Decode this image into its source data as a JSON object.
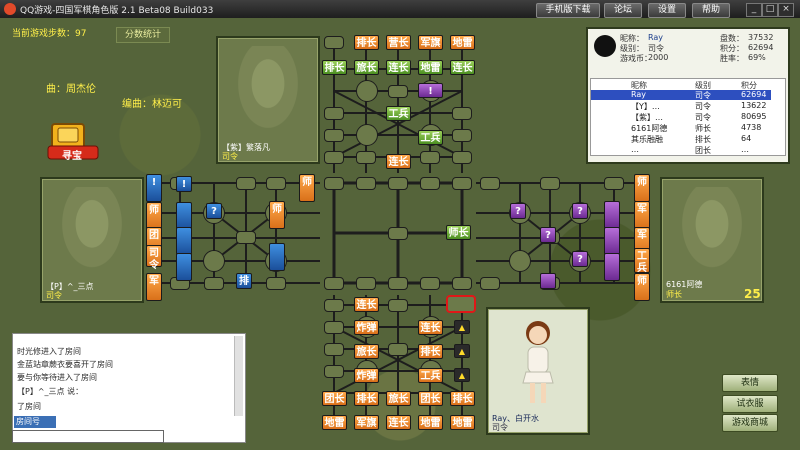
{
  "titlebar": {
    "title": "QQ游戏-四国军棋角色版 2.1 Beta08 Build033",
    "buttons": [
      "手机版下载",
      "论坛",
      "设置",
      "帮助"
    ],
    "window_controls": [
      "_",
      "□",
      "×"
    ]
  },
  "left": {
    "step_count": "当前游戏步数：97",
    "score_button": "分数统计",
    "lyric_line1": "曲：周杰伦",
    "lyric_line2": "编曲：林迈可",
    "treasure_label": "寻宝"
  },
  "seats": {
    "top": {
      "name": "【紫】繁落凡",
      "rank": "司令"
    },
    "left": {
      "name": "【P】^_三点",
      "rank": "司令"
    },
    "right": {
      "name": "6161阿德",
      "rank": "师长",
      "timer": "25"
    },
    "bottom": {
      "name": "Ray、白开水",
      "rank": "司令"
    }
  },
  "board": {
    "north": [
      [
        "排长",
        "营长",
        "军旗",
        "地雷"
      ],
      [
        "排长",
        "旅长",
        "连长",
        "地雷",
        "连长"
      ],
      [
        "!"
      ],
      [
        "工兵"
      ],
      [
        "工兵"
      ],
      [
        "连长"
      ]
    ],
    "west_col1": [
      "!",
      "师",
      "?"
    ],
    "west_labels": [
      "师",
      "团",
      "司令",
      "军"
    ],
    "west_other": [
      "?",
      "师",
      "排",
      "?"
    ],
    "east_labels": [
      "师",
      "军",
      "军",
      "工兵",
      "师"
    ],
    "east_hidden": [
      "?",
      "?",
      "?",
      "?"
    ],
    "center": [
      "师长"
    ],
    "south": [
      [
        "连长"
      ],
      [
        "炸弹",
        "连长"
      ],
      [
        "旅长",
        "排长"
      ],
      [
        "炸弹",
        "工兵"
      ],
      [
        "团长",
        "排长",
        "旅长",
        "团长",
        "排长"
      ],
      [
        "地雷",
        "军旗",
        "连长",
        "地雷",
        "地雷"
      ]
    ],
    "south_markers": [
      "▲",
      "▲",
      "▲",
      "▲",
      "▲"
    ]
  },
  "chat": {
    "lines": [
      "时光修进入了房间",
      "金蓝站章蕨衣要喜开了房间",
      "要与你等待进入了房间",
      "【P】^_三点 说：",
      "了房间"
    ],
    "room_label": "房间号"
  },
  "user": {
    "nick_label": "昵称：",
    "nick": "Ray",
    "level_label": "级别：",
    "level": "司令",
    "games_label": "游戏币：",
    "games": "2000",
    "score_label": "盘数：",
    "score": "37532",
    "points_label": "积分：",
    "points": "62694",
    "winrate_label": "胜率：",
    "winrate": "69%",
    "list_headers": [
      "昵称",
      "级别",
      "积分"
    ],
    "list": [
      {
        "name": "Ray",
        "level": "司令",
        "score": "62694"
      },
      {
        "name": "【Y】…",
        "level": "司令",
        "score": "13622"
      },
      {
        "name": "【紫】…",
        "level": "司令",
        "score": "80695"
      },
      {
        "name": "6161阿德",
        "level": "师长",
        "score": "4738"
      },
      {
        "name": "其乐融融",
        "level": "排长",
        "score": "64"
      },
      {
        "name": "…",
        "level": "团长",
        "score": "…"
      }
    ]
  },
  "actions": {
    "emotion": "表情",
    "clothes": "试衣服",
    "shop": "游戏商城"
  },
  "colors": {
    "orange": "#ff9a3a",
    "green": "#6bb12c",
    "blue": "#2b6fc4",
    "purple": "#8f45b8",
    "board_bg": "#6c7a4a"
  }
}
